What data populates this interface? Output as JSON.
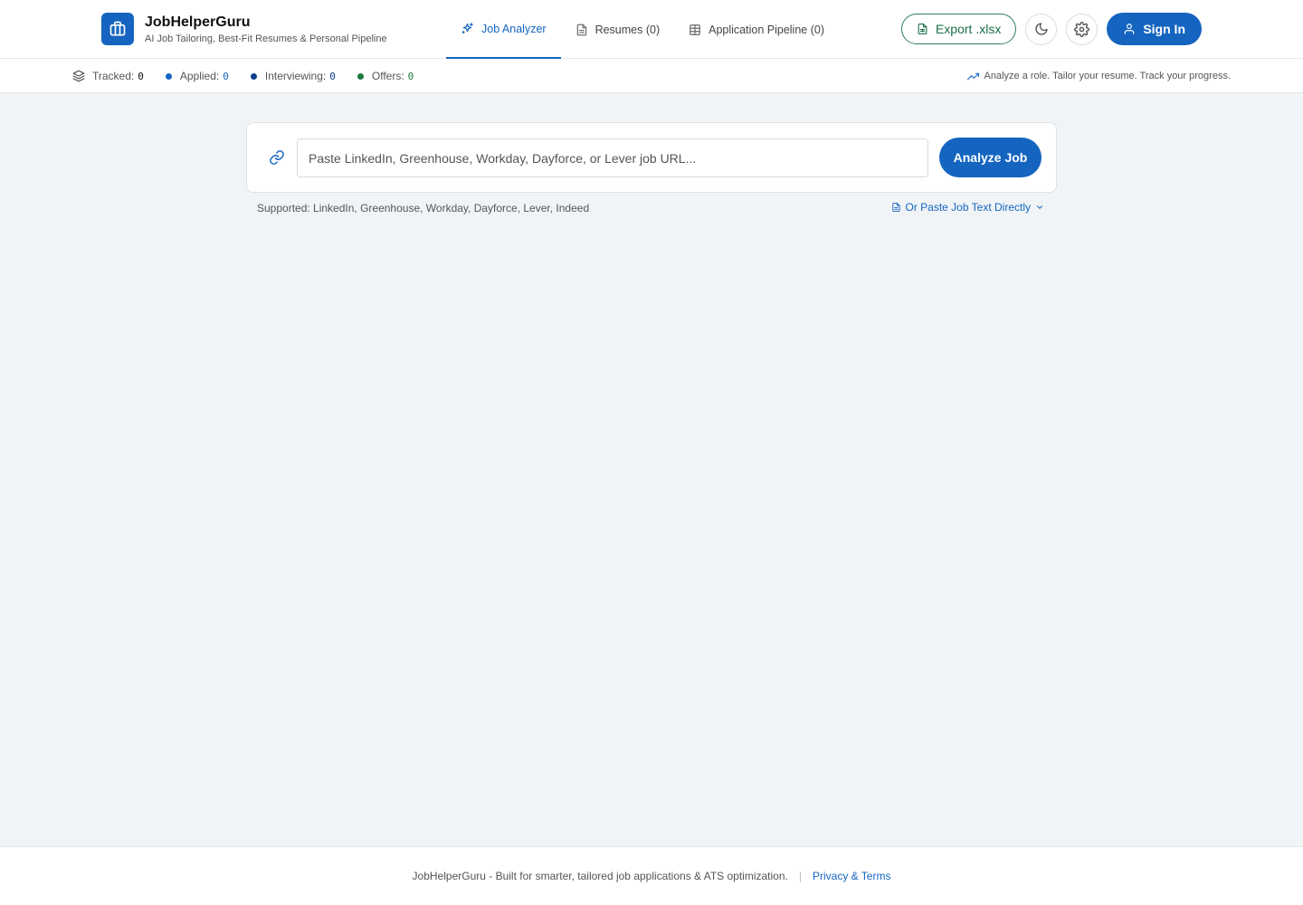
{
  "brand": {
    "name": "JobHelperGuru",
    "tagline": "AI Job Tailoring, Best-Fit Resumes & Personal Pipeline"
  },
  "nav": {
    "tabs": [
      {
        "label": "Job Analyzer",
        "icon": "sparkles-icon",
        "active": true
      },
      {
        "label": "Resumes (0)",
        "icon": "document-icon",
        "active": false
      },
      {
        "label": "Application Pipeline (0)",
        "icon": "table-icon",
        "active": false
      }
    ]
  },
  "actions": {
    "export_label": "Export .xlsx",
    "theme_icon": "moon-icon",
    "settings_icon": "gear-icon",
    "signin_label": "Sign In"
  },
  "stats": {
    "tracked": {
      "label": "Tracked:",
      "value": "0"
    },
    "applied": {
      "label": "Applied:",
      "value": "0",
      "color": "#1565c0"
    },
    "interviewing": {
      "label": "Interviewing:",
      "value": "0",
      "color": "#0d3f8a"
    },
    "offers": {
      "label": "Offers:",
      "value": "0",
      "color": "#1b7a3e"
    },
    "tagline": "Analyze a role. Tailor your resume. Track your progress."
  },
  "search": {
    "placeholder": "Paste LinkedIn, Greenhouse, Workday, Dayforce, or Lever job URL...",
    "value": "",
    "analyze_label": "Analyze Job",
    "supported": "Supported: LinkedIn, Greenhouse, Workday, Dayforce, Lever, Indeed",
    "paste_label": "Or Paste Job Text Directly"
  },
  "footer": {
    "text": "JobHelperGuru - Built for smarter, tailored job applications & ATS optimization.",
    "separator": "|",
    "link": "Privacy & Terms"
  },
  "colors": {
    "accent": "#1565c0",
    "export_green": "#1b6e46",
    "background": "#f0f4f7"
  }
}
